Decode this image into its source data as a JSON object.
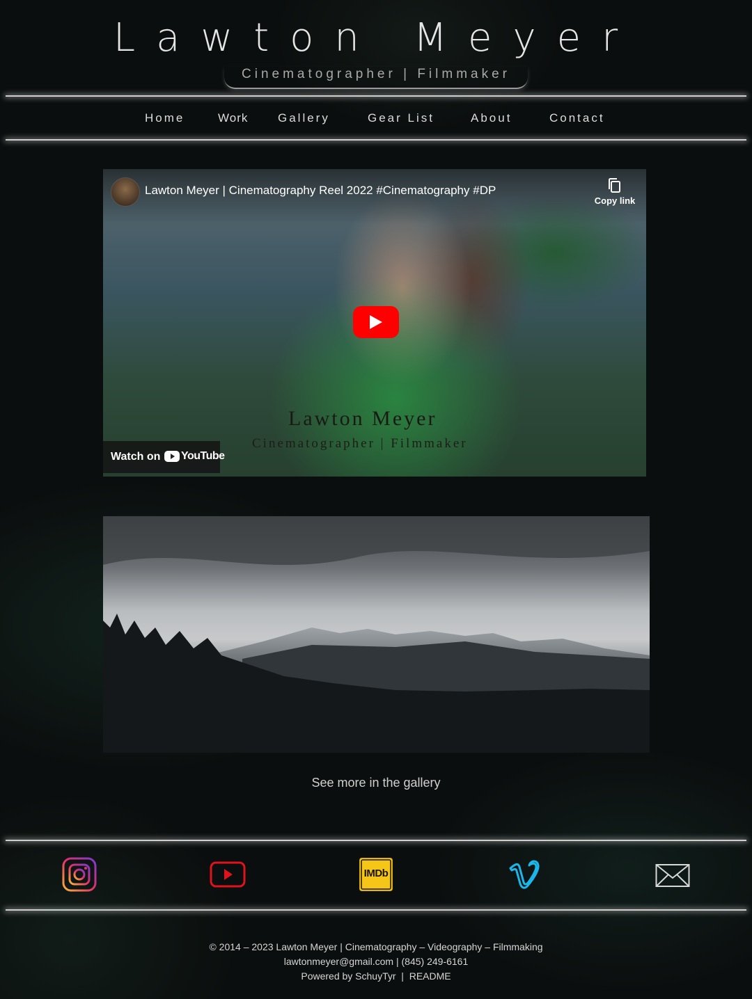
{
  "header": {
    "title": "Lawton Meyer",
    "subtitle": "Cinematographer | Filmmaker"
  },
  "nav": {
    "items": [
      {
        "label": "Home"
      },
      {
        "label": "Work"
      },
      {
        "label": "Gallery"
      },
      {
        "label": "Gear List"
      },
      {
        "label": "About"
      },
      {
        "label": "Contact"
      }
    ]
  },
  "video": {
    "title": "Lawton Meyer | Cinematography Reel 2022 #Cinematography #DP",
    "copy_link_label": "Copy link",
    "thumbnail_name": "Lawton Meyer",
    "thumbnail_subtitle": "Cinematographer | Filmmaker",
    "watch_on_label": "Watch on",
    "youtube_word": "YouTube",
    "play_icon": "play-icon"
  },
  "gallery": {
    "link_text": "See more in the gallery"
  },
  "social": {
    "icons": [
      "instagram-icon",
      "youtube-icon",
      "imdb-icon",
      "vimeo-icon",
      "mail-icon"
    ],
    "imdb_text": "IMDb",
    "colors": {
      "youtube": "#e0121b",
      "imdb": "#f5c518",
      "vimeo": "#1ab7ea"
    }
  },
  "footer": {
    "copyright": "© 2014 – 2023  Lawton Meyer | Cinematography – Videography – Filmmaking",
    "email": "lawtonmeyer@gmail.com",
    "separator": " | ",
    "phone": "(845) 249-6161",
    "powered_by": "Powered by SchuyTyr",
    "pipe": "  |  ",
    "readme": "README"
  }
}
